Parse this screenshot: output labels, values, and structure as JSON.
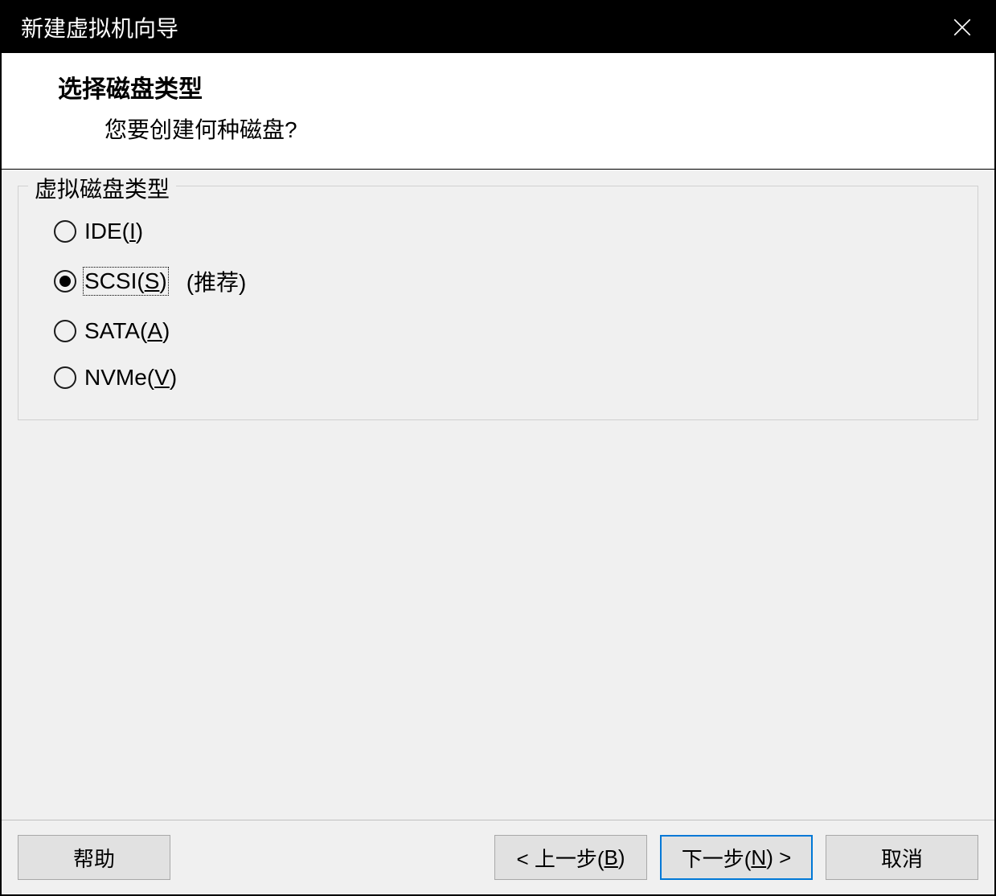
{
  "window": {
    "title": "新建虚拟机向导"
  },
  "header": {
    "title": "选择磁盘类型",
    "subtitle": "您要创建何种磁盘?"
  },
  "fieldset": {
    "legend": "虚拟磁盘类型"
  },
  "options": {
    "ide": {
      "prefix": "IDE(",
      "accel": "I",
      "suffix": ")"
    },
    "scsi": {
      "prefix": "SCSI(",
      "accel": "S",
      "suffix": ")",
      "note": "(推荐)"
    },
    "sata": {
      "prefix": "SATA(",
      "accel": "A",
      "suffix": ")"
    },
    "nvme": {
      "prefix": "NVMe(",
      "accel": "V",
      "suffix": ")"
    }
  },
  "buttons": {
    "help": "帮助",
    "back_prefix": "< 上一步(",
    "back_accel": "B",
    "back_suffix": ")",
    "next_prefix": "下一步(",
    "next_accel": "N",
    "next_suffix": ") >",
    "cancel": "取消"
  }
}
